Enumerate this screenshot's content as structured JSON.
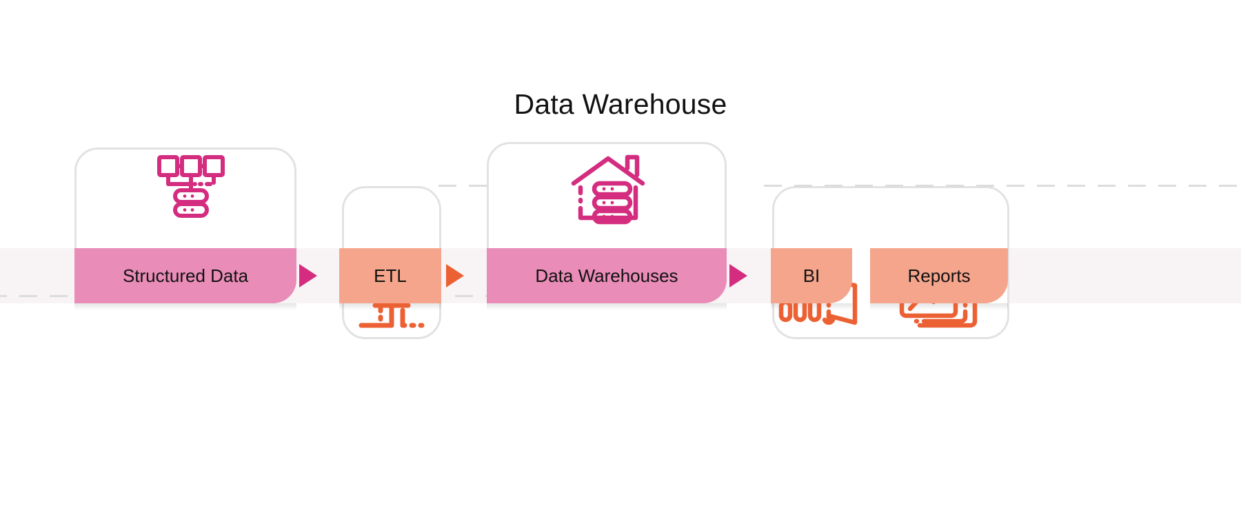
{
  "title": "Data Warehouse",
  "theme": {
    "pink_band": "#E98CB8",
    "peach_band": "#F5A58B",
    "magenta_icon": "#D42D7F",
    "orange_icon": "#EC6134",
    "band_background": "#F8F4F5",
    "card_border": "#E2E2E2",
    "text": "#111111"
  },
  "flow": {
    "stages": [
      {
        "id": "structured-data",
        "label": "Structured Data",
        "icon": "structured-data-network-icon",
        "color": "pink"
      },
      {
        "id": "etl",
        "label": "ETL",
        "icon": "etl-arrow-icon",
        "color": "peach"
      },
      {
        "id": "data-warehouses",
        "label": "Data Warehouses",
        "icon": "warehouse-server-icon",
        "color": "pink"
      },
      {
        "id": "bi",
        "label": "BI",
        "icon": "bar-chart-bi-icon",
        "color": "peach"
      },
      {
        "id": "reports",
        "label": "Reports",
        "icon": "report-trend-documents-icon",
        "color": "peach"
      }
    ],
    "connectors": [
      {
        "id": "arrow-1",
        "from": "structured-data",
        "to": "etl",
        "color": "pink"
      },
      {
        "id": "arrow-2",
        "from": "etl",
        "to": "data-warehouses",
        "color": "orange"
      },
      {
        "id": "arrow-3",
        "from": "data-warehouses",
        "to": "bi",
        "color": "pink"
      }
    ]
  }
}
